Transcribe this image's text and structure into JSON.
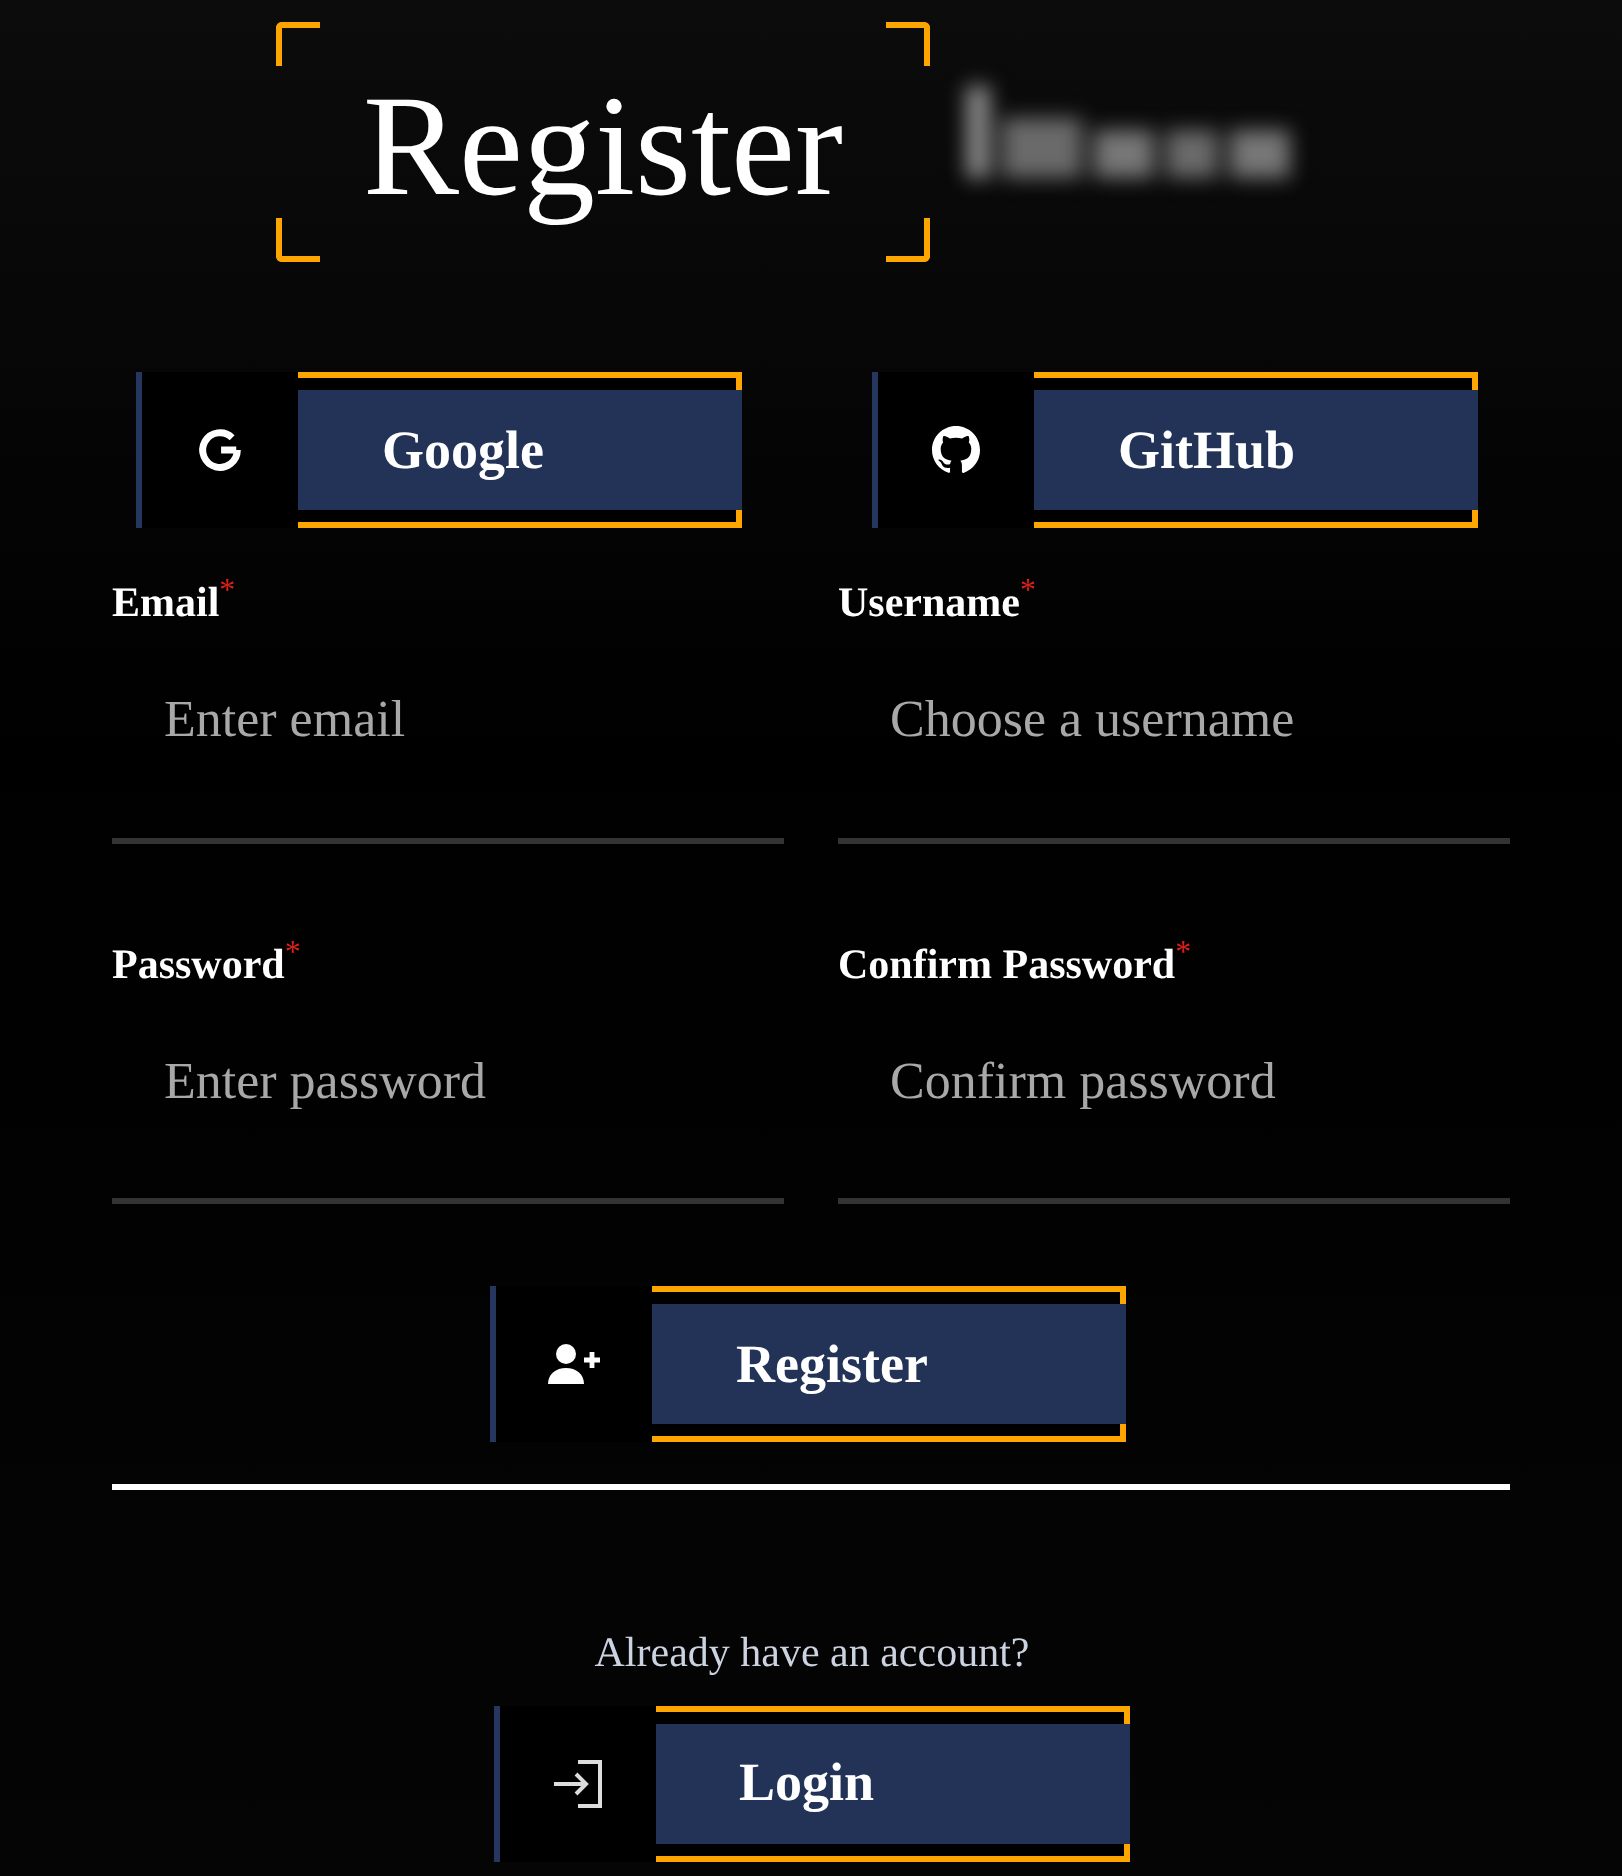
{
  "title": {
    "text": "Register"
  },
  "social_buttons": [
    {
      "kind": "google",
      "label": "Google"
    },
    {
      "kind": "github",
      "label": "GitHub"
    }
  ],
  "fields": [
    {
      "label": "Email",
      "required_mark": "*",
      "placeholder": "Enter email"
    },
    {
      "label": "Username",
      "required_mark": "*",
      "placeholder": "Choose a username"
    },
    {
      "label": "Password",
      "required_mark": "*",
      "placeholder": "Enter password"
    },
    {
      "label": "Confirm Password",
      "required_mark": "*",
      "placeholder": "Confirm password"
    }
  ],
  "submit": {
    "kind": "register",
    "label": "Register"
  },
  "footer": {
    "prompt": "Already have an account?",
    "button": {
      "kind": "login",
      "label": "Login"
    }
  }
}
